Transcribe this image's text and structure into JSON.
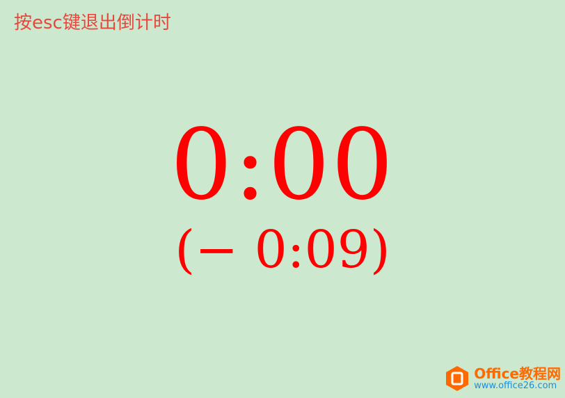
{
  "hint_text": "按esc键退出倒计时",
  "timer": {
    "remaining": "0:00",
    "overtime": "(− 0:09)"
  },
  "watermark": {
    "name": "Office教程网",
    "url": "www.office26.com",
    "logo_icon": "office-logo-icon"
  },
  "colors": {
    "background": "#cce8cf",
    "timer": "#ff0000",
    "hint": "#e8473c",
    "brand_orange": "#ff6a00",
    "brand_blue": "#1e8fd9"
  }
}
